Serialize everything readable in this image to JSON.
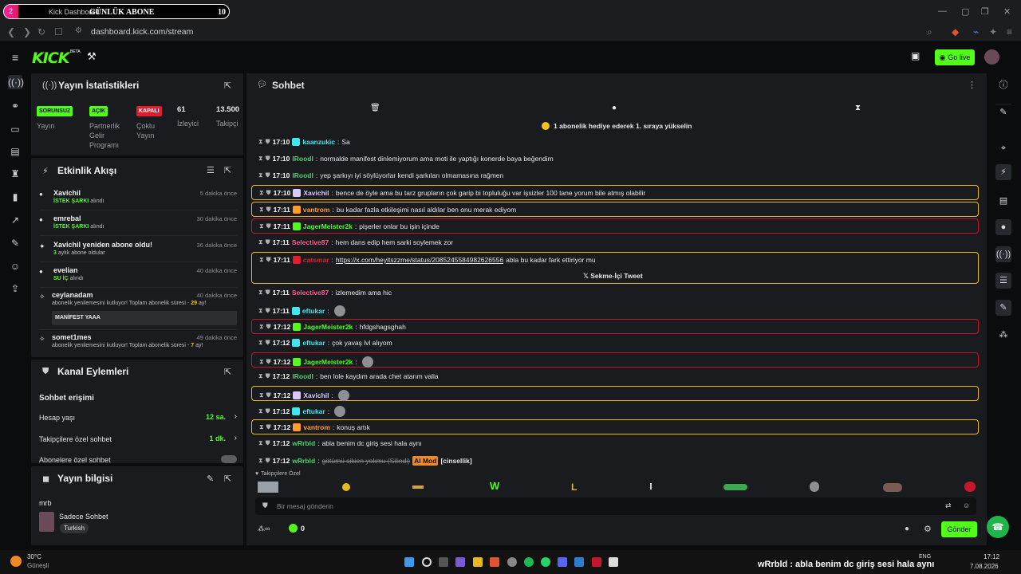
{
  "browser": {
    "tab_title": "Kick Dashboard",
    "overlay_title": "GÜNLÜK ABONE",
    "overlay_count": "10",
    "overlay_badge": "2",
    "url": "dashboard.kick.com/stream"
  },
  "header": {
    "logo": "KICK",
    "beta": "BETA",
    "go_live": "Go live"
  },
  "stats": {
    "title": "Yayın İstatistikleri",
    "items": [
      {
        "badge": "SORUNSUZ",
        "badge_color": "#53fc18",
        "label": "Yayın"
      },
      {
        "badge": "AÇIK",
        "badge_color": "#53fc18",
        "label": "Partnerlik Gelir Programı"
      },
      {
        "badge": "KAPALI",
        "badge_color": "#e11d2e",
        "label": "Çoklu Yayın"
      },
      {
        "value": "61",
        "label": "İzleyici"
      },
      {
        "value": "13.500",
        "label": "Takipçi"
      }
    ]
  },
  "feed": {
    "title": "Etkinlik Akışı",
    "items": [
      {
        "name": "Xavichil",
        "sub": "İSTEK ŞARKI",
        "sub2": "alındı",
        "time": "5 dakika önce"
      },
      {
        "name": "emrebal",
        "sub": "İSTEK ŞARKI",
        "sub2": "alındı",
        "time": "30 dakika önce"
      },
      {
        "name": "Xavichil yeniden abone oldu!",
        "sub": "3",
        "sub2": "aylık abone oldular",
        "time": "36 dakika önce"
      },
      {
        "name": "evelian",
        "sub": "SU İÇ",
        "sub2": "alındı",
        "time": "40 dakika önce"
      },
      {
        "name": "ceylanadam",
        "sub": "abonelik yenilemesini kutluyor! Toplam abonelik süresi -",
        "sub_num": "29",
        "sub3": "ay!",
        "msg": "MANİFEST YAAA",
        "time": "40 dakika önce"
      },
      {
        "name": "somet1mes",
        "sub": "abonelik yenilemesini kutluyor! Toplam abonelik süresi -",
        "sub_num": "7",
        "sub3": "ay!",
        "time": "49 dakika önce"
      }
    ]
  },
  "channel": {
    "title": "Kanal Eylemleri",
    "section": "Sohbet erişimi",
    "rows": [
      {
        "label": "Hesap yaşı",
        "value": "12 sa."
      },
      {
        "label": "Takipçilere özel sohbet",
        "value": "1 dk."
      },
      {
        "label": "Abonelere özel sohbet",
        "value": ""
      }
    ]
  },
  "info": {
    "title": "Yayın bilgisi",
    "stream_title": "mrb",
    "category": "Sadece Sohbet",
    "language": "Turkish"
  },
  "chat": {
    "title": "Sohbet",
    "banner": "1 abonelik hediye ederek 1. sıraya yükselin",
    "messages": [
      {
        "time": "17:10",
        "user": "kaanzukic",
        "color": "#3ee6f0",
        "text": "Sa",
        "style": ""
      },
      {
        "time": "17:10",
        "user": "IRoodI",
        "color": "#4fd06b",
        "text": "normalde manifest dinlemiyorum ama moti ile yaptığı konerde baya beğendim",
        "style": ""
      },
      {
        "time": "17:10",
        "user": "IRoodI",
        "color": "#4fd06b",
        "text": "yep şarkıyı iyi söylüyorlar kendi şarkıları olmamasına rağmen",
        "style": ""
      },
      {
        "time": "17:10",
        "user": "Xavichil",
        "color": "#d9c9ff",
        "text": "bence de öyle ama bu tarz grupların çok garip bi topluluğu var işsizler 100 tane yorum bile atmış olabilir",
        "style": "gold"
      },
      {
        "time": "17:11",
        "user": "vantrom",
        "color": "#ff9b2f",
        "text": "bu kadar fazla etkileşimi nasıl aldılar ben onu merak ediyom",
        "style": "gold"
      },
      {
        "time": "17:11",
        "user": "JagerMeister2k",
        "color": "#53fc18",
        "text": "pişerler onlar bu işin içinde",
        "style": "red"
      },
      {
        "time": "17:11",
        "user": "Selective87",
        "color": "#ff5a8a",
        "text": "hem dans edip hem sarki soylemek zor",
        "style": ""
      },
      {
        "time": "17:11",
        "user": "catsmar",
        "color": "#e11d2e",
        "text": "abla bu kadar fark ettiriyor mu",
        "link": "https://x.com/heyitszzme/status/2085245584982626556",
        "embed": "Sekme-İçi Tweet",
        "style": "gold"
      },
      {
        "time": "17:11",
        "user": "Selective87",
        "color": "#ff5a8a",
        "text": "izlemedim ama hic",
        "style": ""
      },
      {
        "time": "17:11",
        "user": "eftukar",
        "color": "#3ee6f0",
        "text": "",
        "style": ""
      },
      {
        "time": "17:12",
        "user": "JagerMeister2k",
        "color": "#53fc18",
        "text": "hfdgshagsghah",
        "style": "red"
      },
      {
        "time": "17:12",
        "user": "eftukar",
        "color": "#3ee6f0",
        "text": "çok yavaş lvl alıyom",
        "style": ""
      },
      {
        "time": "17:12",
        "user": "JagerMeister2k",
        "color": "#53fc18",
        "text": "",
        "style": "red"
      },
      {
        "time": "17:12",
        "user": "IRoodI",
        "color": "#4fd06b",
        "text": "ben lole kaydım arada chet atarım valla",
        "style": ""
      },
      {
        "time": "17:12",
        "user": "Xavichil",
        "color": "#d9c9ff",
        "text": "",
        "style": "gold"
      },
      {
        "time": "17:12",
        "user": "eftukar",
        "color": "#3ee6f0",
        "text": "",
        "style": ""
      },
      {
        "time": "17:12",
        "user": "vantrom",
        "color": "#ff9b2f",
        "text": "konuş artık",
        "style": "gold"
      },
      {
        "time": "17:12",
        "user": "wRrbld",
        "color": "#4fd06b",
        "text": "abla benim dc giriş sesi hala aynı",
        "style": ""
      },
      {
        "time": "17:12",
        "user": "wRrbld",
        "color": "#4fd06b",
        "text": "götümü sikien yokmu (Silindi)",
        "mod": "AI Mod",
        "tag": "[cinsellik]",
        "style": "deleted"
      }
    ],
    "emote_label": "Takipçilere Özel",
    "input_placeholder": "Bir mesaj gönderin",
    "viewer_count": "0",
    "send": "Gönder"
  },
  "taskbar": {
    "weather_temp": "30°C",
    "weather_desc": "Güneşli",
    "ticker": "wRrbld : abla benim dc giriş sesi hala aynı",
    "time": "17:12",
    "date": "7.08.2026",
    "lang": "ENG"
  }
}
